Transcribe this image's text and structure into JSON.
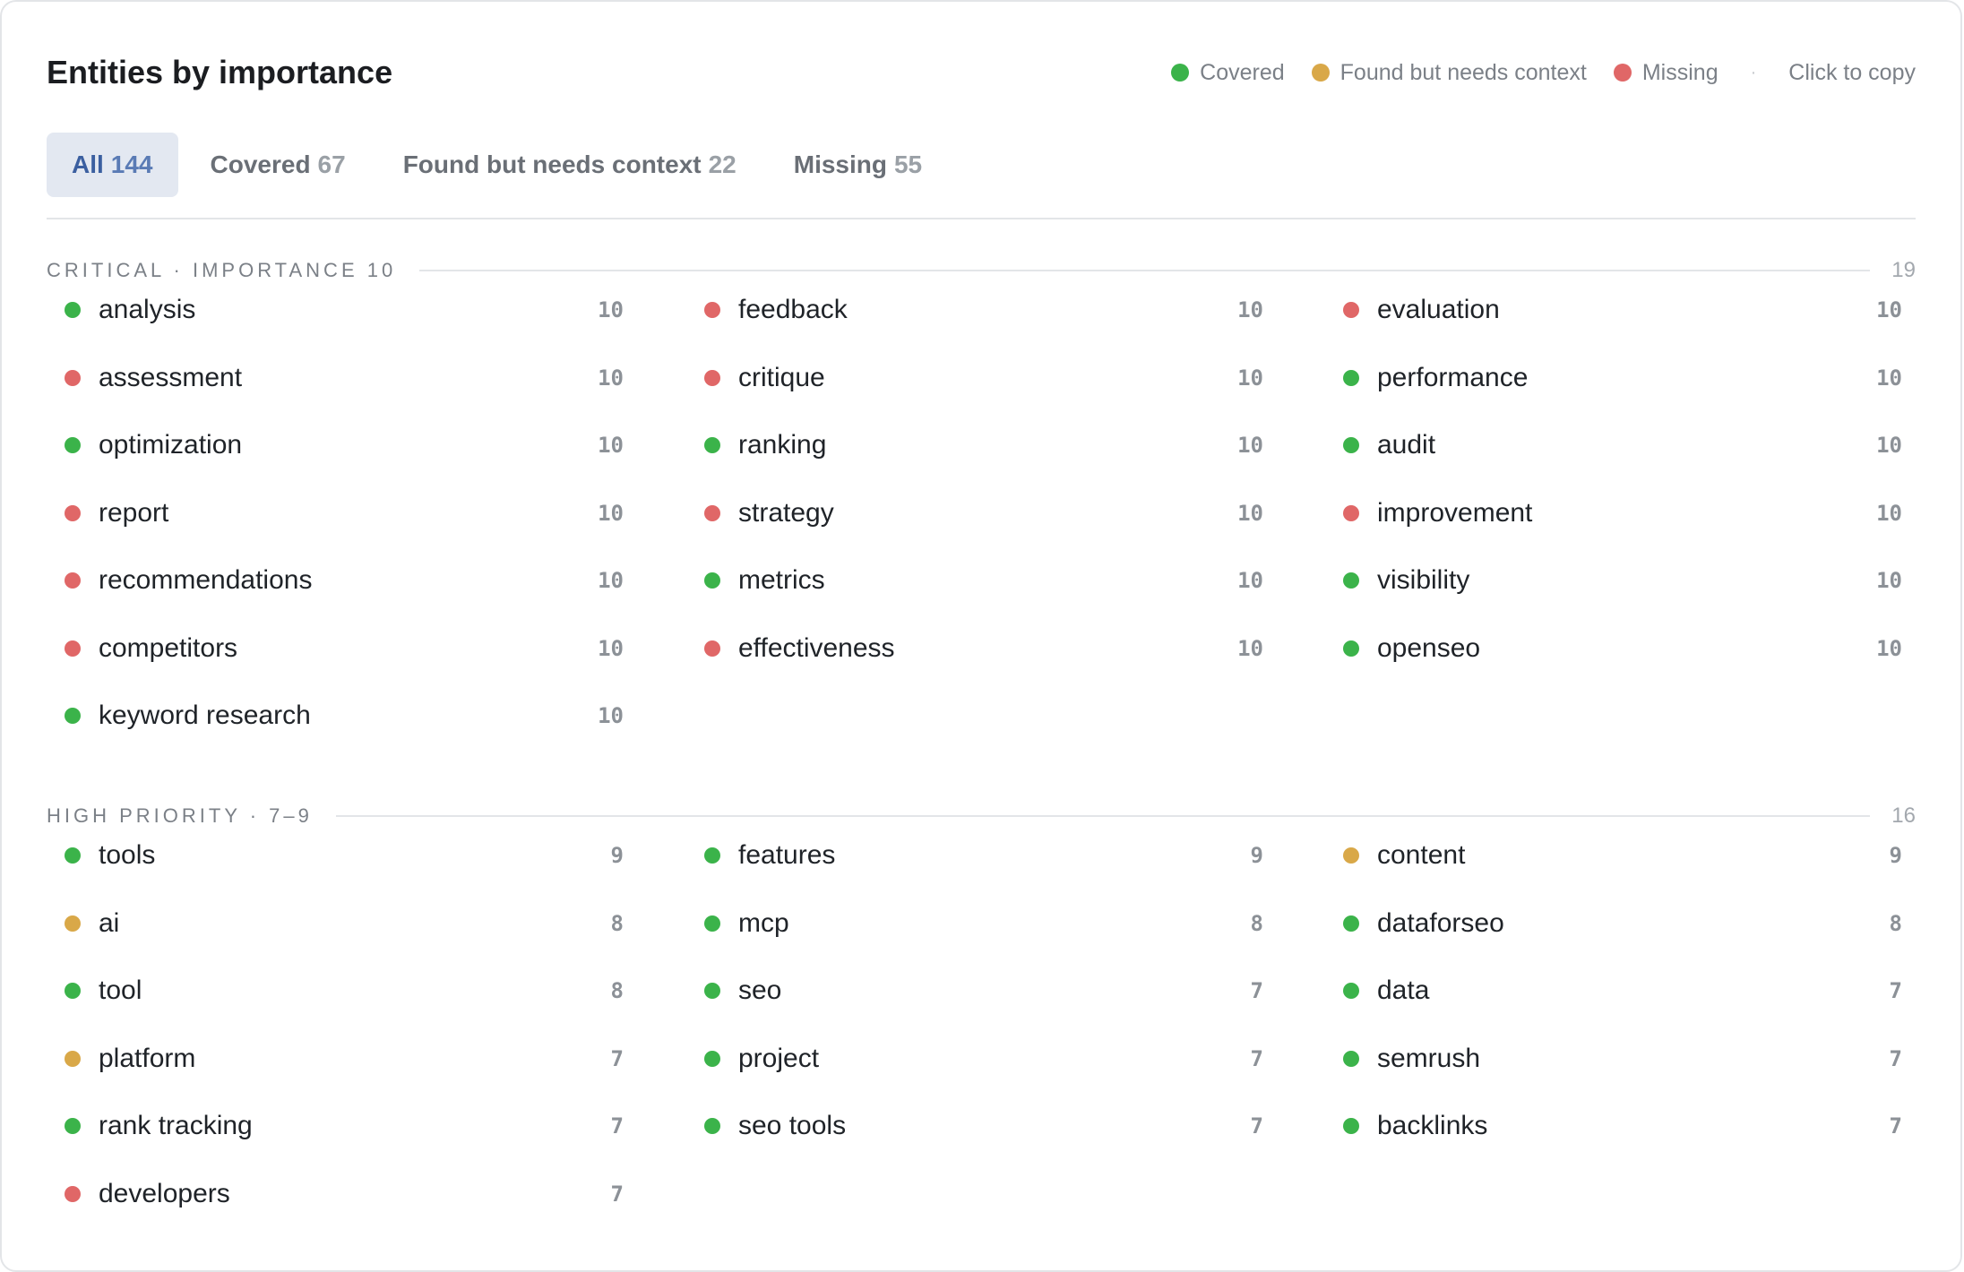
{
  "title": "Entities by importance",
  "legend": {
    "items": [
      {
        "label": "Covered",
        "status": "covered"
      },
      {
        "label": "Found but needs context",
        "status": "context"
      },
      {
        "label": "Missing",
        "status": "missing"
      }
    ],
    "separator": "·",
    "copy_hint": "Click to copy"
  },
  "colors": {
    "covered": "#3bb34a",
    "context": "#d9a848",
    "missing": "#e06767"
  },
  "tabs": [
    {
      "label": "All",
      "count": "144",
      "active": true
    },
    {
      "label": "Covered",
      "count": "67",
      "active": false
    },
    {
      "label": "Found but needs context",
      "count": "22",
      "active": false
    },
    {
      "label": "Missing",
      "count": "55",
      "active": false
    }
  ],
  "sections": [
    {
      "label": "CRITICAL · IMPORTANCE 10",
      "count": "19",
      "items": [
        {
          "name": "analysis",
          "score": "10",
          "status": "covered"
        },
        {
          "name": "feedback",
          "score": "10",
          "status": "missing"
        },
        {
          "name": "evaluation",
          "score": "10",
          "status": "missing"
        },
        {
          "name": "assessment",
          "score": "10",
          "status": "missing"
        },
        {
          "name": "critique",
          "score": "10",
          "status": "missing"
        },
        {
          "name": "performance",
          "score": "10",
          "status": "covered"
        },
        {
          "name": "optimization",
          "score": "10",
          "status": "covered"
        },
        {
          "name": "ranking",
          "score": "10",
          "status": "covered"
        },
        {
          "name": "audit",
          "score": "10",
          "status": "covered"
        },
        {
          "name": "report",
          "score": "10",
          "status": "missing"
        },
        {
          "name": "strategy",
          "score": "10",
          "status": "missing"
        },
        {
          "name": "improvement",
          "score": "10",
          "status": "missing"
        },
        {
          "name": "recommendations",
          "score": "10",
          "status": "missing"
        },
        {
          "name": "metrics",
          "score": "10",
          "status": "covered"
        },
        {
          "name": "visibility",
          "score": "10",
          "status": "covered"
        },
        {
          "name": "competitors",
          "score": "10",
          "status": "missing"
        },
        {
          "name": "effectiveness",
          "score": "10",
          "status": "missing"
        },
        {
          "name": "openseo",
          "score": "10",
          "status": "covered"
        },
        {
          "name": "keyword research",
          "score": "10",
          "status": "covered"
        }
      ]
    },
    {
      "label": "HIGH PRIORITY · 7–9",
      "count": "16",
      "items": [
        {
          "name": "tools",
          "score": "9",
          "status": "covered"
        },
        {
          "name": "features",
          "score": "9",
          "status": "covered"
        },
        {
          "name": "content",
          "score": "9",
          "status": "context"
        },
        {
          "name": "ai",
          "score": "8",
          "status": "context"
        },
        {
          "name": "mcp",
          "score": "8",
          "status": "covered"
        },
        {
          "name": "dataforseo",
          "score": "8",
          "status": "covered"
        },
        {
          "name": "tool",
          "score": "8",
          "status": "covered"
        },
        {
          "name": "seo",
          "score": "7",
          "status": "covered"
        },
        {
          "name": "data",
          "score": "7",
          "status": "covered"
        },
        {
          "name": "platform",
          "score": "7",
          "status": "context"
        },
        {
          "name": "project",
          "score": "7",
          "status": "covered"
        },
        {
          "name": "semrush",
          "score": "7",
          "status": "covered"
        },
        {
          "name": "rank tracking",
          "score": "7",
          "status": "covered"
        },
        {
          "name": "seo tools",
          "score": "7",
          "status": "covered"
        },
        {
          "name": "backlinks",
          "score": "7",
          "status": "covered"
        },
        {
          "name": "developers",
          "score": "7",
          "status": "missing"
        }
      ]
    }
  ]
}
